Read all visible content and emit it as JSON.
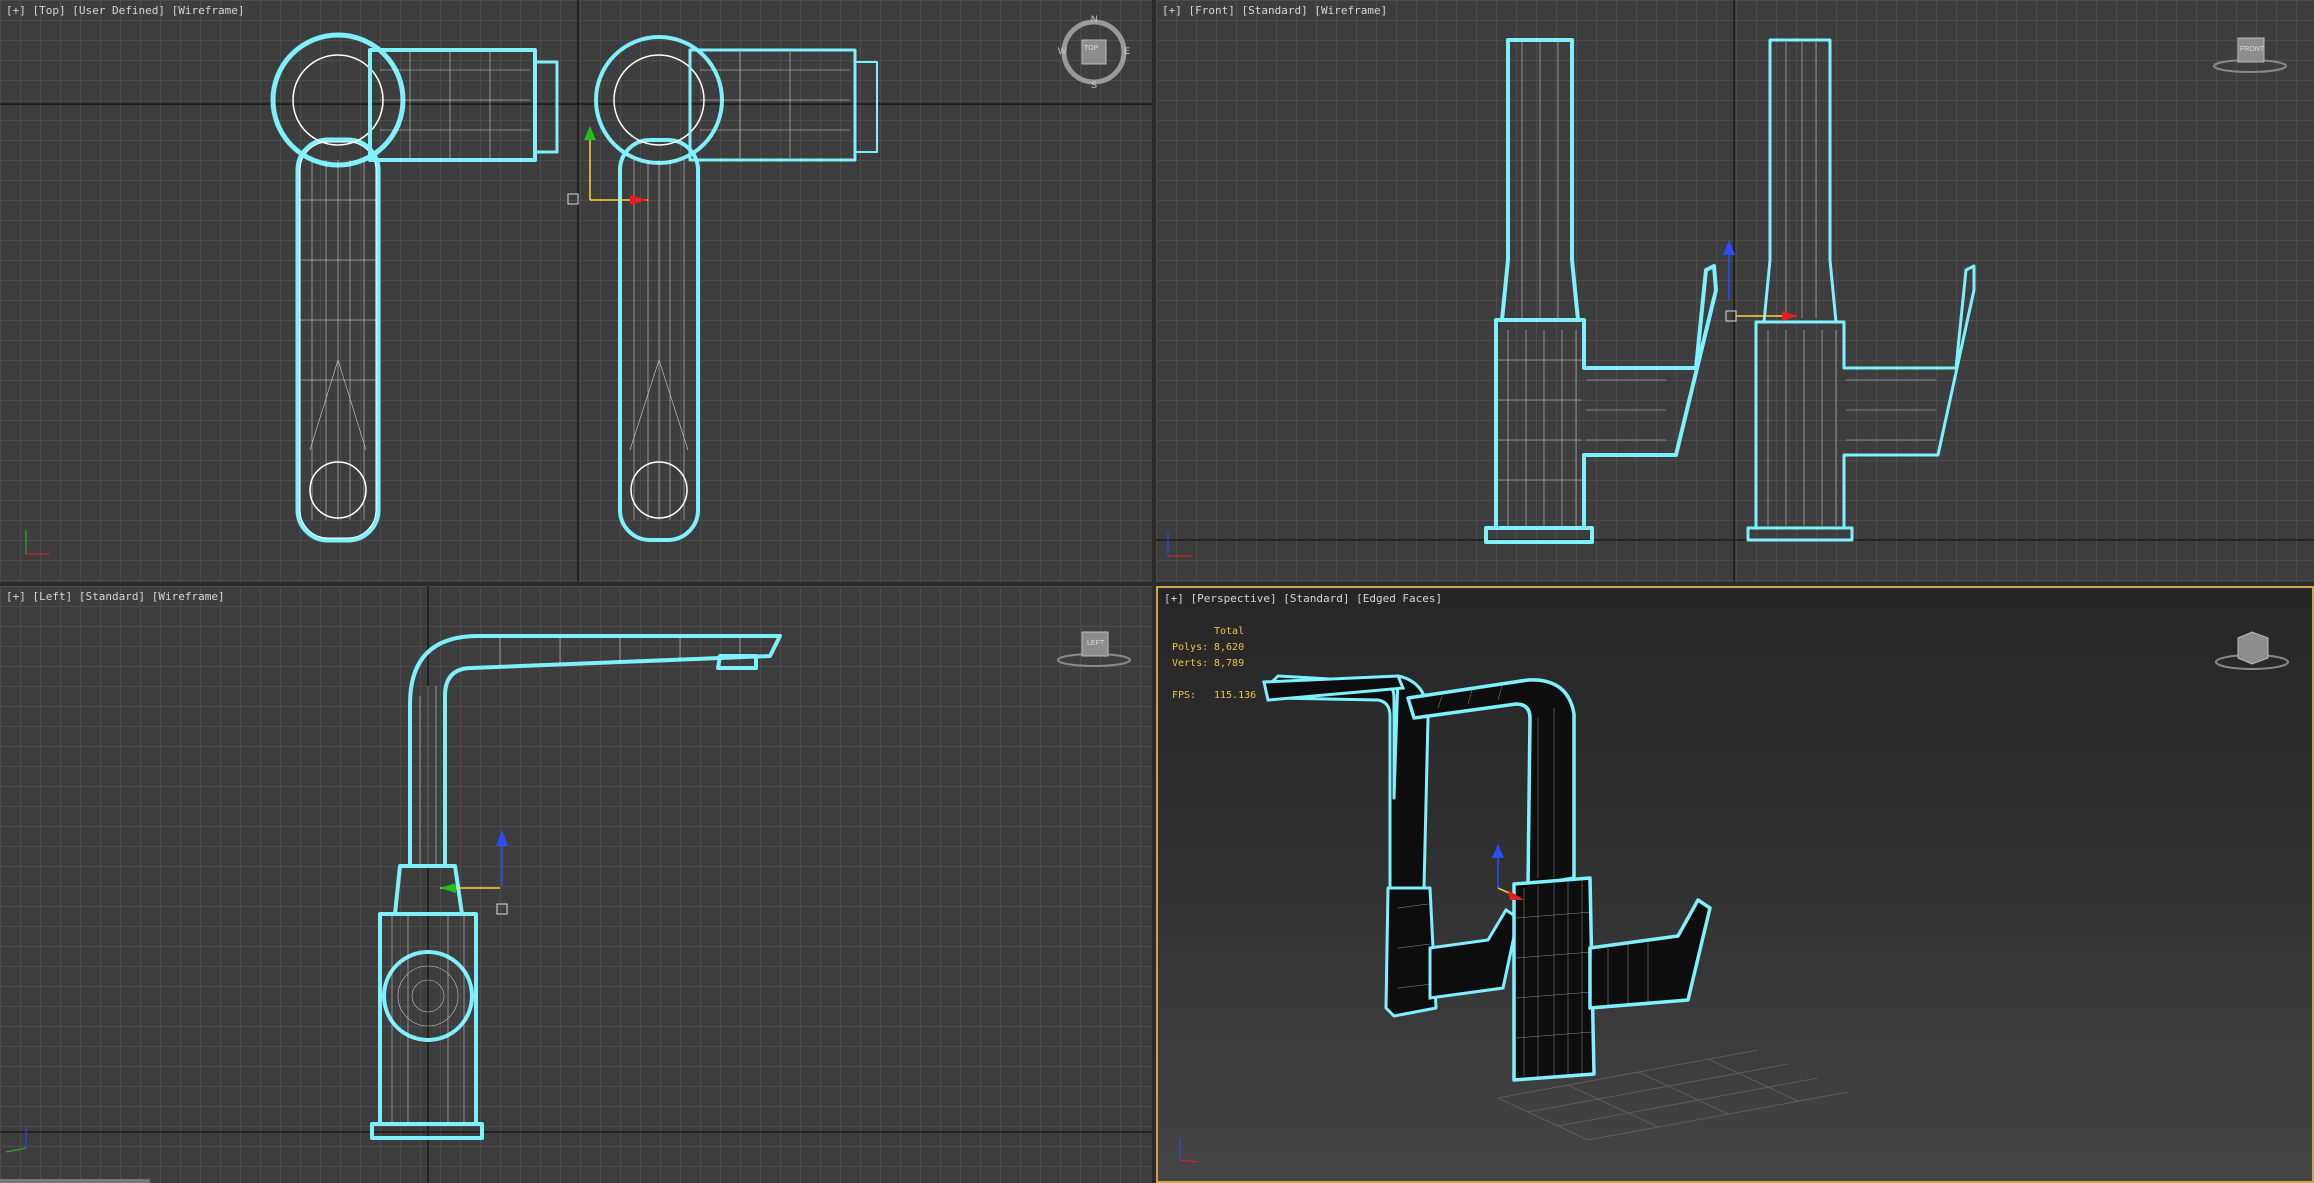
{
  "viewports": {
    "top": {
      "plus": "[+]",
      "view": "[Top]",
      "mode": "[User Defined]",
      "shading": "[Wireframe]",
      "compass": {
        "n": "N",
        "s": "S",
        "e": "E",
        "w": "W",
        "cube": "TOP"
      }
    },
    "front": {
      "plus": "[+]",
      "view": "[Front]",
      "mode": "[Standard]",
      "shading": "[Wireframe]",
      "cube": "FRONT"
    },
    "left": {
      "plus": "[+]",
      "view": "[Left]",
      "mode": "[Standard]",
      "shading": "[Wireframe]",
      "cube": "LEFT"
    },
    "perspective": {
      "plus": "[+]",
      "view": "[Perspective]",
      "mode": "[Standard]",
      "shading": "[Edged Faces]",
      "stats": {
        "header": "Total",
        "polys_label": "Polys:",
        "polys_value": "8,620",
        "verts_label": "Verts:",
        "verts_value": "8,789",
        "fps_label": "FPS:",
        "fps_value": "115.136"
      }
    }
  },
  "colors": {
    "selection": "#7ff0ff",
    "wire": "#ffffff",
    "axis_x": "#e02020",
    "axis_y": "#20c020",
    "axis_z": "#2a4cff",
    "active_border": "#c8a64a",
    "stats_text": "#e8c84a"
  }
}
